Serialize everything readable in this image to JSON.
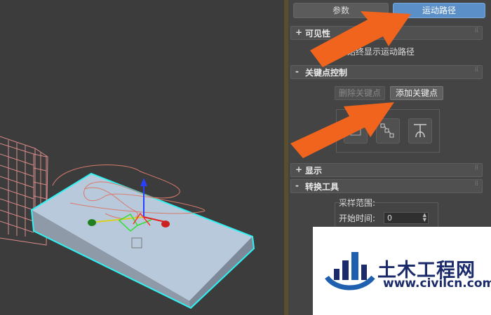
{
  "panel": {
    "tabs": [
      {
        "label": "参数",
        "active": false
      },
      {
        "label": "运动路径",
        "active": true
      }
    ],
    "rollouts": {
      "visibility": {
        "sign": "+",
        "title": "可见性",
        "option": "始终显示运动路径",
        "option_prefix_hidden": true
      },
      "key_control": {
        "sign": "-",
        "title": "关键点控制",
        "delete_key": "删除关键点",
        "add_key": "添加关键点"
      },
      "display": {
        "sign": "+",
        "title": "显示"
      },
      "conversion": {
        "sign": "-",
        "title": "转换工具",
        "range_label": "采样范围:",
        "start_label": "开始时间:",
        "start_value": "0"
      }
    }
  },
  "colors": {
    "active_tab": "#5a8fc8",
    "arrow": "#f0641e",
    "object_top": "#c0cfe0",
    "selection": "#00ffff"
  },
  "watermark": {
    "title": "土木工程网",
    "url": "www.civilcn.com"
  }
}
